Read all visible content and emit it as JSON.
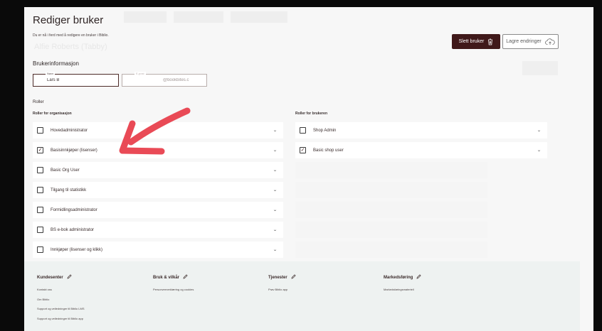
{
  "page": {
    "title": "Rediger bruker",
    "subtitle": "Du er nå i ferd med å redigere en bruker i Biblio.",
    "background_user": "Alfie Roberts (Tabby)"
  },
  "actions": {
    "delete_label": "Slett bruker",
    "save_label": "Lagre endringer"
  },
  "user_info": {
    "section_title": "Brukerinformasjon",
    "name_label": "Navn",
    "name_value": "Lars B",
    "email_label": "E-post",
    "email_value": "@bookbites.c"
  },
  "roles": {
    "title": "Roller",
    "org_title": "Roller for organisasjon",
    "user_title": "Roller for brukeren",
    "org_roles": [
      {
        "label": "Hovedadministrator",
        "checked": false
      },
      {
        "label": "Basisinnkjøper (lisenser)",
        "checked": true
      },
      {
        "label": "Basic Org User",
        "checked": false
      },
      {
        "label": "Tilgang til statistikk",
        "checked": false
      },
      {
        "label": "Formidlingsadministrator",
        "checked": false
      },
      {
        "label": "BS e-bok administrator",
        "checked": false
      },
      {
        "label": "Innkjøper (lisenser og klikk)",
        "checked": false
      }
    ],
    "user_roles": [
      {
        "label": "Shop Admin",
        "checked": false
      },
      {
        "label": "Basic shop user",
        "checked": true
      }
    ]
  },
  "footer": {
    "columns": [
      {
        "title": "Kundesenter",
        "links": [
          "Kontakt oss",
          "Om Biblio",
          "Support og veiledninger til Biblio LMS",
          "Support og veiledninger til Biblio app"
        ]
      },
      {
        "title": "Bruk & vilkår",
        "links": [
          "Personvernerklæring og cookies"
        ]
      },
      {
        "title": "Tjenester",
        "links": [
          "Prøv Biblio app"
        ]
      },
      {
        "title": "Markedsføring",
        "links": [
          "Markedsføringsmateriell"
        ]
      }
    ]
  },
  "colors": {
    "brand_dark": "#40191a",
    "annotation_arrow": "#e94a56",
    "footer_bg": "#eef2f1"
  },
  "icons": {
    "delete": "trash-icon",
    "save": "cloud-upload-icon",
    "footer_edit": "pencil-icon",
    "dropdown": "chevron-down-icon",
    "annotation": "arrow-annotation"
  }
}
